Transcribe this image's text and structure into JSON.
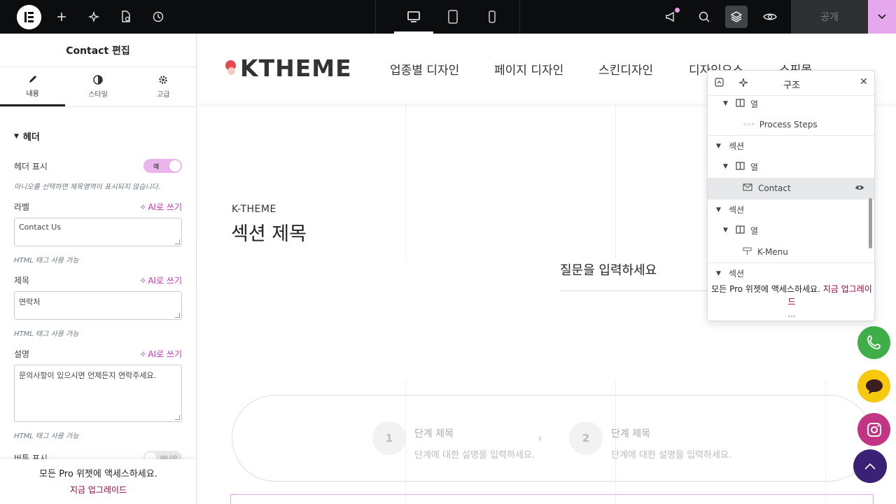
{
  "topbar": {
    "publish_label": "공개",
    "icons": [
      "elementor-logo-icon",
      "plus-icon",
      "sparkle-ai-icon",
      "page-settings-icon",
      "history-icon",
      "desktop-icon",
      "tablet-icon",
      "mobile-icon",
      "megaphone-icon",
      "search-icon",
      "layers-icon",
      "eye-icon",
      "chevron-down-icon"
    ]
  },
  "panel": {
    "title": "Contact 편집",
    "tabs": [
      {
        "label": "내용",
        "icon": "pencil-icon"
      },
      {
        "label": "스타일",
        "icon": "half-circle-icon"
      },
      {
        "label": "고급",
        "icon": "gear-icon"
      }
    ],
    "section_header": "헤더",
    "show_header_label": "헤더 표시",
    "show_header_value": "예",
    "show_header_hint": "아니오를 선택하면 제목영역이 표시되지 않습니다.",
    "ai_label": "AI로 쓰기",
    "label_label": "라벨",
    "label_value": "Contact Us",
    "title_label": "제목",
    "title_value": "연락처",
    "desc_label": "설명",
    "desc_value": "문의사항이 있으시면 언제든지 연락주세요.",
    "html_hint": "HTML 태그 사용 가능",
    "button_show_label": "버튼 표시",
    "button_show_value": "아니오",
    "promo_text": "모든 Pro 위젯에 액세스하세요.",
    "promo_link": "지금 업그레이드"
  },
  "site": {
    "brand": "KTHEME",
    "nav": [
      "업종별 디자인",
      "페이지 디자인",
      "스킨디자인",
      "디자인요소",
      "쇼핑몰"
    ],
    "eyebrow": "K-THEME",
    "section_title": "섹션 제목",
    "question": "질문을 입력하세요",
    "steps": [
      {
        "num": "1",
        "title": "단계 제목",
        "desc": "단계에 대한 설명을 입력하세요."
      },
      {
        "num": "2",
        "title": "단계 제목",
        "desc": "단계에 대한 설명을 입력하세요."
      }
    ]
  },
  "structure": {
    "title": "구조",
    "items": [
      {
        "label": "열",
        "type": "column"
      },
      {
        "label": "Process Steps",
        "type": "widget"
      },
      {
        "label": "섹션",
        "type": "section"
      },
      {
        "label": "열",
        "type": "column"
      },
      {
        "label": "Contact",
        "type": "widget"
      },
      {
        "label": "섹션",
        "type": "section"
      },
      {
        "label": "열",
        "type": "column"
      },
      {
        "label": "K-Menu",
        "type": "widget"
      },
      {
        "label": "섹션",
        "type": "section"
      }
    ],
    "promo_text": "모든 Pro 위젯에 액세스하세요.",
    "promo_link_1": "지금 업그레이",
    "promo_link_2": "드",
    "more": "···"
  },
  "colors": {
    "topbar": "#0c0d0e",
    "accent_pink": "#e9b5ea",
    "upgrade": "#93003f",
    "brand_red": "#e3494f",
    "fab_phone": "#3fae49",
    "fab_chat": "#f6c90e",
    "fab_instagram": "#c13584",
    "fab_top": "#3b2176"
  }
}
